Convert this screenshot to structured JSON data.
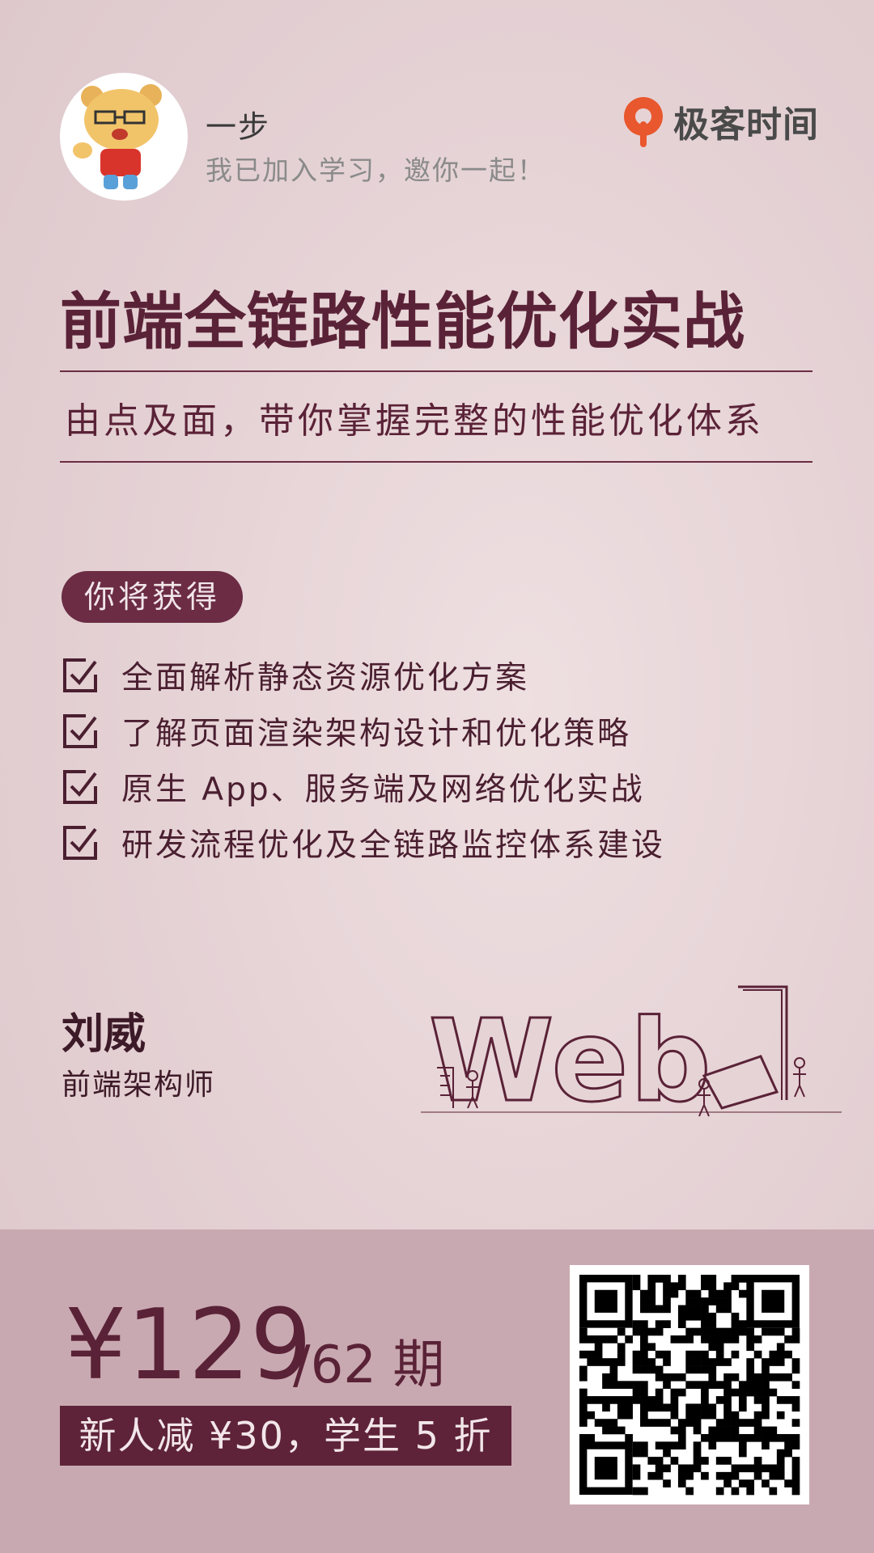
{
  "user": {
    "name": "一步",
    "message": "我已加入学习，邀你一起！"
  },
  "brand": {
    "name": "极客时间",
    "logo_icon": "geektime-logo-icon",
    "logo_color": "#e9572e"
  },
  "course": {
    "title": "前端全链路性能优化实战",
    "subtitle": "由点及面，带你掌握完整的性能优化体系"
  },
  "gains": {
    "label": "你将获得",
    "items": [
      "全面解析静态资源优化方案",
      "了解页面渲染架构设计和优化策略",
      "原生 App、服务端及网络优化实战",
      "研发流程优化及全链路监控体系建设"
    ]
  },
  "author": {
    "name": "刘威",
    "title": "前端架构师"
  },
  "illustration": {
    "word": "Web"
  },
  "pricing": {
    "price": "¥129",
    "lessons": "/62 期",
    "promo": "新人减 ¥30，学生 5 折"
  },
  "colors": {
    "accent": "#6b2c44",
    "bottom_band": "#c9a9b1",
    "background": "#e6d3d6"
  }
}
